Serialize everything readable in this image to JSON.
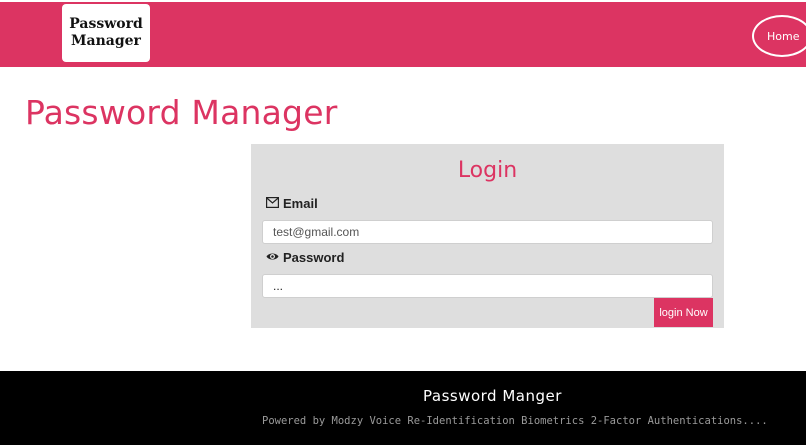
{
  "header": {
    "logo_line1": "Password",
    "logo_line2": "Manager",
    "home_label": "Home",
    "brand_color": "#dc3462"
  },
  "main": {
    "page_title": "Password Manager"
  },
  "login": {
    "title": "Login",
    "email_label": "Email",
    "email_value": "test@gmail.com",
    "password_label": "Password",
    "password_value": "...",
    "button_label": "login Now",
    "icons": {
      "email": "envelope-icon",
      "password": "eye-icon"
    }
  },
  "footer": {
    "title": "Password Manger",
    "subtitle": "Powered by Modzy Voice Re-Identification Biometrics 2-Factor Authentications...."
  }
}
